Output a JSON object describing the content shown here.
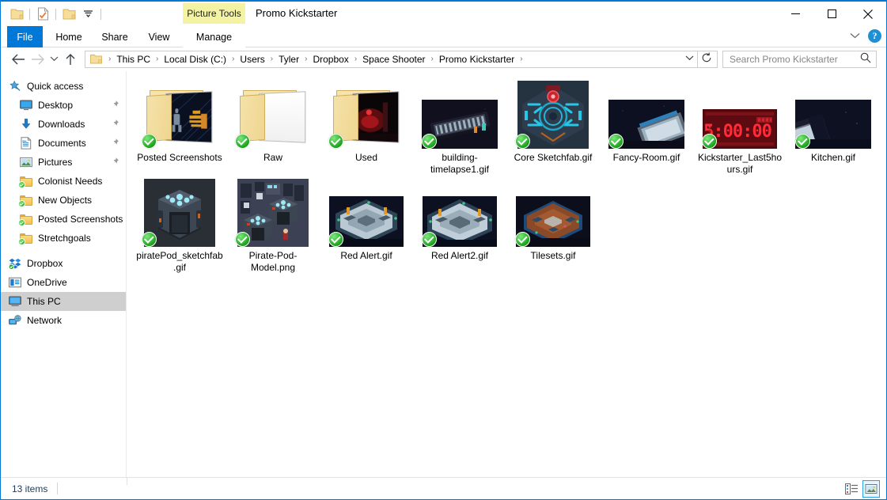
{
  "window": {
    "title": "Promo Kickstarter",
    "contextual_tab_group": "Picture Tools",
    "minimize_label": "–",
    "maximize_label": "❐",
    "close_label": "✕",
    "accent_color": "#0078d7",
    "contextual_tab_color": "#f3f3a3"
  },
  "quick_access_toolbar": {
    "items": [
      {
        "name": "folder-icon",
        "label": ""
      },
      {
        "name": "properties-icon",
        "label": ""
      },
      {
        "name": "new-folder-icon",
        "label": ""
      },
      {
        "name": "chevron-down-icon",
        "label": "▾"
      }
    ]
  },
  "ribbon": {
    "tabs": [
      {
        "id": "file",
        "label": "File"
      },
      {
        "id": "home",
        "label": "Home"
      },
      {
        "id": "share",
        "label": "Share"
      },
      {
        "id": "view",
        "label": "View"
      },
      {
        "id": "manage",
        "label": "Manage"
      }
    ],
    "collapse_label": "⌄",
    "help_label": "?"
  },
  "navigation": {
    "back_label": "←",
    "forward_label": "→",
    "recent_label": "⌄",
    "up_label": "↑",
    "breadcrumbs": [
      "This PC",
      "Local Disk (C:)",
      "Users",
      "Tyler",
      "Dropbox",
      "Space Shooter",
      "Promo Kickstarter"
    ],
    "separator": "›",
    "dropdown_label": "⌄",
    "refresh_label": "↻"
  },
  "search": {
    "placeholder": "Search Promo Kickstarter",
    "icon": "search-icon"
  },
  "sidebar": {
    "groups": [
      {
        "id": "quick-access",
        "label": "Quick access",
        "icon": "star-pin-icon",
        "items": [
          {
            "label": "Desktop",
            "icon": "desktop-icon",
            "pinned": true,
            "synced": false
          },
          {
            "label": "Downloads",
            "icon": "download-icon",
            "pinned": true,
            "synced": false
          },
          {
            "label": "Documents",
            "icon": "document-icon",
            "pinned": true,
            "synced": false
          },
          {
            "label": "Pictures",
            "icon": "pictures-icon",
            "pinned": true,
            "synced": false
          },
          {
            "label": "Colonist Needs",
            "icon": "folder-icon",
            "pinned": false,
            "synced": true
          },
          {
            "label": "New Objects",
            "icon": "folder-icon",
            "pinned": false,
            "synced": true
          },
          {
            "label": "Posted Screenshots",
            "icon": "folder-icon",
            "pinned": false,
            "synced": true
          },
          {
            "label": "Stretchgoals",
            "icon": "folder-icon",
            "pinned": false,
            "synced": true
          }
        ]
      },
      {
        "id": "roots",
        "label": "",
        "icon": "",
        "items": [
          {
            "label": "Dropbox",
            "icon": "dropbox-icon",
            "pinned": false,
            "synced": true,
            "selected": false
          },
          {
            "label": "OneDrive",
            "icon": "onedrive-icon",
            "pinned": false,
            "synced": false,
            "selected": false
          },
          {
            "label": "This PC",
            "icon": "this-pc-icon",
            "pinned": false,
            "synced": false,
            "selected": true
          },
          {
            "label": "Network",
            "icon": "network-icon",
            "pinned": false,
            "synced": false,
            "selected": false
          }
        ]
      }
    ]
  },
  "files": [
    {
      "name": "Posted Screenshots",
      "type": "folder",
      "synced": true,
      "thumb": "sketch-blueprint"
    },
    {
      "name": "Raw",
      "type": "folder",
      "synced": true,
      "thumb": "blank-pages"
    },
    {
      "name": "Used",
      "type": "folder",
      "synced": true,
      "thumb": "red-scene"
    },
    {
      "name": "building-timelapse1.gif",
      "type": "file",
      "synced": true,
      "thumb": "timelapse-corridor"
    },
    {
      "name": "Core Sketchfab.gif",
      "type": "file",
      "synced": true,
      "thumb": "core-reactor"
    },
    {
      "name": "Fancy-Room.gif",
      "type": "file",
      "synced": true,
      "thumb": "fancy-room"
    },
    {
      "name": "Kickstarter_Last5hours.gif",
      "type": "file",
      "synced": true,
      "thumb": "countdown-timer",
      "timer_text": "5:00:00"
    },
    {
      "name": "Kitchen.gif",
      "type": "file",
      "synced": true,
      "thumb": "kitchen-dark"
    },
    {
      "name": "piratePod_sketchfab.gif",
      "type": "file",
      "synced": true,
      "thumb": "pirate-pod"
    },
    {
      "name": "Pirate-Pod-Model.png",
      "type": "file",
      "synced": true,
      "thumb": "pirate-pod-model"
    },
    {
      "name": "Red Alert.gif",
      "type": "file",
      "synced": true,
      "thumb": "ship-interior-a"
    },
    {
      "name": "Red Alert2.gif",
      "type": "file",
      "synced": true,
      "thumb": "ship-interior-b"
    },
    {
      "name": "Tilesets.gif",
      "type": "file",
      "synced": true,
      "thumb": "tileset-brown"
    }
  ],
  "statusbar": {
    "item_count": "13 items",
    "views": [
      {
        "id": "details",
        "label": "Details view",
        "active": false
      },
      {
        "id": "large-icons",
        "label": "Large icons view",
        "active": true
      }
    ]
  }
}
